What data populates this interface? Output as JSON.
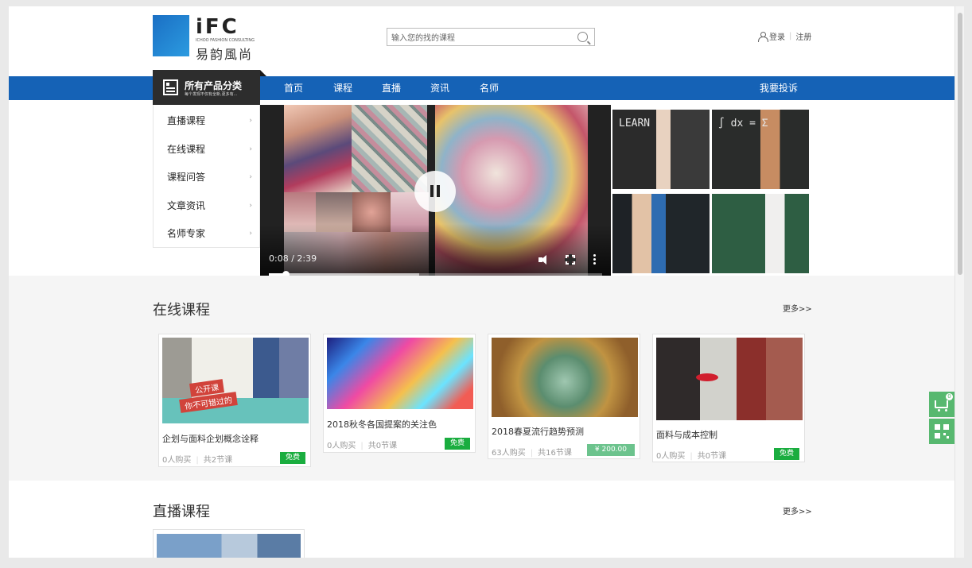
{
  "logo": {
    "brand": "iFC",
    "subtitle": "ICHOO FASHION CONSULTING",
    "name_cn": "易韵風尚"
  },
  "search": {
    "placeholder": "输入您的找的课程"
  },
  "auth": {
    "login": "登录",
    "separator": "|",
    "register": "注册"
  },
  "category": {
    "title": "所有产品分类",
    "subtitle": "每个发现不仅有全新,更多有...",
    "items": [
      {
        "label": "直播课程"
      },
      {
        "label": "在线课程"
      },
      {
        "label": "课程问答"
      },
      {
        "label": "文章资讯"
      },
      {
        "label": "名师专家"
      }
    ],
    "arrow": "›"
  },
  "nav": {
    "items": [
      {
        "label": "首页"
      },
      {
        "label": "课程"
      },
      {
        "label": "直播"
      },
      {
        "label": "资讯"
      },
      {
        "label": "名师"
      }
    ],
    "complaint": "我要投诉"
  },
  "video": {
    "time": "0:08 / 2:39",
    "progress": 0.05,
    "buffered": 0.45,
    "state": "playing"
  },
  "teachers": {
    "chalk_texts": [
      "LEARN",
      "∫ dx = Σ",
      "",
      ""
    ]
  },
  "online_section": {
    "title": "在线课程",
    "more": "更多>>",
    "courses": [
      {
        "name": "企划与面料企划概念诠释",
        "buyers": "0人购买",
        "lessons": "共2节课",
        "price": "免费",
        "img_tag1": "公开课",
        "img_tag2": "你不可错过的"
      },
      {
        "name": "2018秋冬各国提案的关注色",
        "buyers": "0人购买",
        "lessons": "共0节课",
        "price": "免费"
      },
      {
        "name": "2018春夏流行趋势预测",
        "buyers": "63人购买",
        "lessons": "共16节课",
        "price": "¥ 200.00"
      },
      {
        "name": "面料与成本控制",
        "buyers": "0人购买",
        "lessons": "共0节课",
        "price": "免费"
      }
    ]
  },
  "live_section": {
    "title": "直播课程",
    "more": "更多>>"
  },
  "float_bar": {
    "cart_badge": "0"
  },
  "colors": {
    "nav_blue": "#1562b6",
    "free_green": "#1aad3f",
    "paid_green": "#6cc38d",
    "float_green": "#57b86f"
  }
}
